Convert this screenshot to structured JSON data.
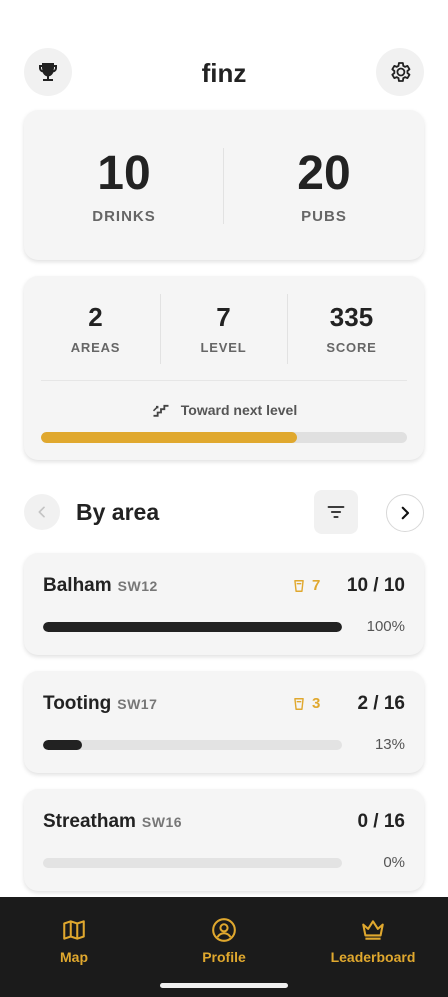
{
  "header": {
    "title": "finz",
    "left_icon": "trophy-icon",
    "right_icon": "gear-icon"
  },
  "summary": {
    "drinks": {
      "value": "10",
      "label": "DRINKS"
    },
    "pubs": {
      "value": "20",
      "label": "PUBS"
    }
  },
  "stats": {
    "areas": {
      "value": "2",
      "label": "AREAS"
    },
    "level": {
      "value": "7",
      "label": "LEVEL"
    },
    "score": {
      "value": "335",
      "label": "SCORE"
    },
    "next_level_label": "Toward next level",
    "next_level_progress": 0.7
  },
  "section": {
    "title": "By area"
  },
  "areas": [
    {
      "name": "Balham",
      "code": "SW12",
      "drinks": "7",
      "count": "10 / 10",
      "percent_label": "100%",
      "progress": 1.0
    },
    {
      "name": "Tooting",
      "code": "SW17",
      "drinks": "3",
      "count": "2 / 16",
      "percent_label": "13%",
      "progress": 0.13
    },
    {
      "name": "Streatham",
      "code": "SW16",
      "drinks": "",
      "count": "0 / 16",
      "percent_label": "0%",
      "progress": 0.0
    }
  ],
  "nav": {
    "items": [
      {
        "label": "Map",
        "icon": "map-icon"
      },
      {
        "label": "Profile",
        "icon": "profile-icon"
      },
      {
        "label": "Leaderboard",
        "icon": "crown-icon"
      }
    ]
  },
  "colors": {
    "accent": "#e0a82e",
    "nav_background": "#1b1b1b",
    "card_background": "#f5f5f5"
  }
}
